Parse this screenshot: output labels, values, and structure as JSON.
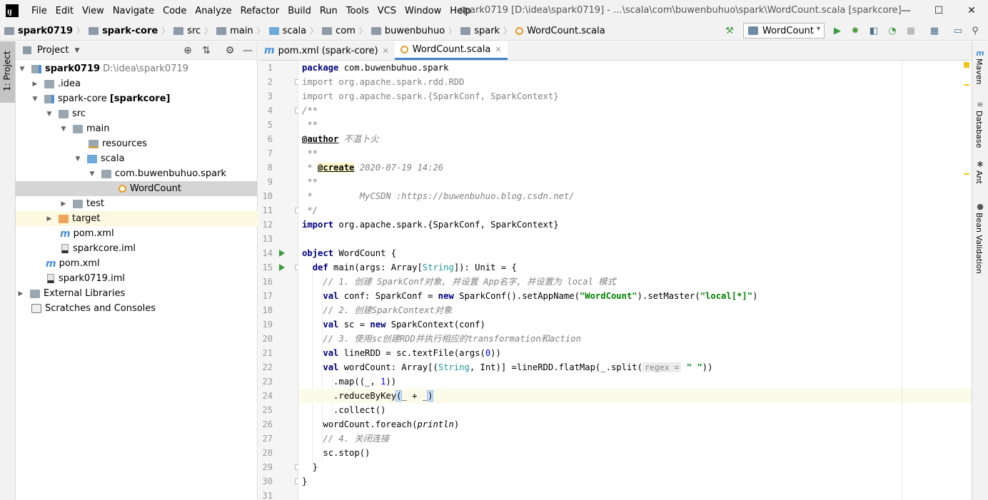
{
  "menubar": {
    "logo": "IJ",
    "items": [
      "File",
      "Edit",
      "View",
      "Navigate",
      "Code",
      "Analyze",
      "Refactor",
      "Build",
      "Run",
      "Tools",
      "VCS",
      "Window",
      "Help"
    ],
    "title": "spark0719 [D:\\idea\\spark0719] - ...\\scala\\com\\buwenbuhuo\\spark\\WordCount.scala [sparkcore]",
    "minimize": "—",
    "maximize": "☐",
    "close": "✕"
  },
  "navbar": {
    "crumbs": [
      "spark0719",
      "spark-core",
      "src",
      "main",
      "scala",
      "com",
      "buwenbuhuo",
      "spark",
      "WordCount.scala"
    ],
    "run_config": "WordCount"
  },
  "left_stripe": {
    "tab_label": "1: Project"
  },
  "project": {
    "title": "Project",
    "tree": [
      {
        "label": "spark0719",
        "extra": "D:\\idea\\spark0719"
      },
      {
        "label": ".idea"
      },
      {
        "label": "spark-core",
        "extra": "[sparkcore]"
      },
      {
        "label": "src"
      },
      {
        "label": "main"
      },
      {
        "label": "resources"
      },
      {
        "label": "scala"
      },
      {
        "label": "com.buwenbuhuo.spark"
      },
      {
        "label": "WordCount"
      },
      {
        "label": "test"
      },
      {
        "label": "target"
      },
      {
        "label": "pom.xml"
      },
      {
        "label": "sparkcore.iml"
      },
      {
        "label": "pom.xml"
      },
      {
        "label": "spark0719.iml"
      },
      {
        "label": "External Libraries"
      },
      {
        "label": "Scratches and Consoles"
      }
    ]
  },
  "tabs": [
    {
      "label": "pom.xml (spark-core)"
    },
    {
      "label": "WordCount.scala"
    }
  ],
  "editor": {
    "line_numbers": [
      "1",
      "2",
      "3",
      "4",
      "5",
      "6",
      "7",
      "8",
      "9",
      "10",
      "11",
      "12",
      "13",
      "14",
      "15",
      "16",
      "17",
      "18",
      "19",
      "20",
      "21",
      "22",
      "23",
      "24",
      "25",
      "26",
      "27",
      "28",
      "29",
      "30",
      "31"
    ],
    "code": {
      "l1_kw": "package",
      "l1_rest": " com.buwenbuhuo.spark",
      "l2_kw": "import",
      "l2_rest": " org.apache.spark.rdd.RDD",
      "l3_kw": "import",
      "l3_rest": " org.apache.spark.{SparkConf, SparkContext}",
      "l4": "/**",
      "l5": " **",
      "l6_ann": "@author",
      "l6_rest": " 不温卜火",
      "l7": " **",
      "l8_pre": " * ",
      "l8_ann": "@create",
      "l8_rest": " 2020-07-19 14:26",
      "l9": " **",
      "l10": " *         MyCSDN :https://buwenbuhuo.blog.csdn.net/",
      "l11": " */",
      "l12_kw": "import",
      "l12_rest": " org.apache.spark.{SparkConf, SparkContext}",
      "l14_kw": "object",
      "l14_rest": " WordCount {",
      "l15_kw": "def",
      "l15_a": " main(args: Array[",
      "l15_type": "String",
      "l15_b": "]): Unit = {",
      "l16": "// 1. 创建 SparkConf对象, 并设置 App名字, 并设置为 local 模式",
      "l17_kw": "val",
      "l17_a": " conf: SparkConf = ",
      "l17_kw2": "new",
      "l17_b": " SparkConf().setAppName(",
      "l17_s1": "\"WordCount\"",
      "l17_c": ").setMaster(",
      "l17_s2": "\"local[*]\"",
      "l17_d": ")",
      "l18": "// 2. 创建SparkContext对象",
      "l19_kw": "val",
      "l19_a": " sc = ",
      "l19_kw2": "new",
      "l19_b": " SparkContext(conf)",
      "l20": "// 3. 使用sc创建RDD并执行相应的transformation和action",
      "l21_kw": "val",
      "l21_a": " lineRDD = sc.textFile(args(",
      "l21_num": "0",
      "l21_b": "))",
      "l22_kw": "val",
      "l22_a": " wordCount: Array[(",
      "l22_t1": "String",
      "l22_b": ", Int)] =lineRDD.flatMap(_.split(",
      "l22_hint": "regex =",
      "l22_s": "\" \"",
      "l22_c": "))",
      "l23_a": ".map((_, ",
      "l23_num": "1",
      "l23_b": "))",
      "l24_a": ".reduceByKey",
      "l24_open": "(",
      "l24_mid": "_ + _",
      "l24_close": ")",
      "l25": ".collect()",
      "l26_a": "wordCount.foreach(",
      "l26_fn": "println",
      "l26_b": ")",
      "l27": "// 4. 关闭连接",
      "l28": "sc.stop()",
      "l29": "}",
      "l30": "}"
    }
  },
  "right_stripe": [
    "Maven",
    "Database",
    "Ant",
    "Bean Validation"
  ]
}
